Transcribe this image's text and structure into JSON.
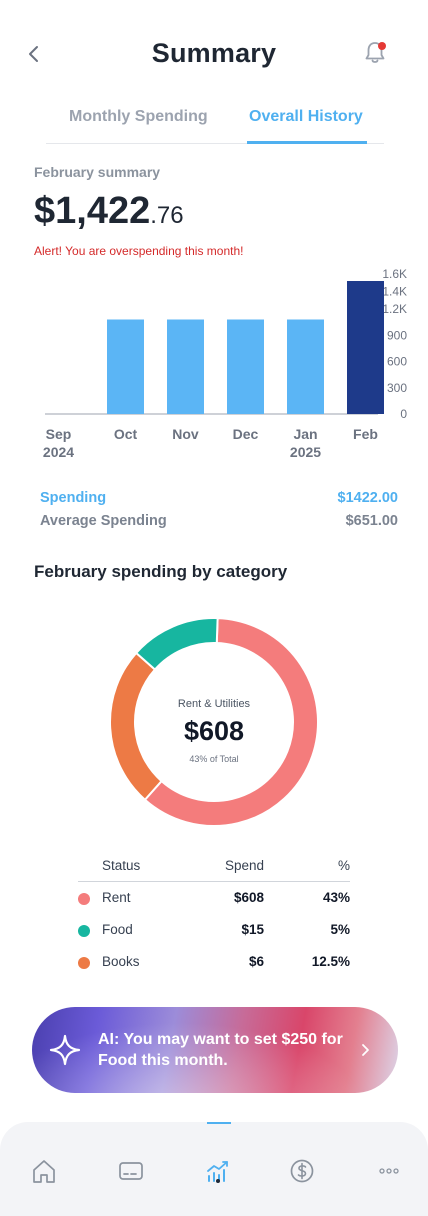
{
  "header": {
    "title": "Summary"
  },
  "tabs": [
    {
      "label": "Monthly Spending",
      "active": false
    },
    {
      "label": "Overall History",
      "active": true
    }
  ],
  "summary": {
    "label": "February summary",
    "amount_main": "$1,422",
    "amount_cents": ".76",
    "alert": "Alert! You are overspending this month!"
  },
  "chart_data": {
    "type": "bar",
    "categories": [
      "Sep 2024",
      "Oct",
      "Nov",
      "Dec",
      "Jan 2025",
      "Feb"
    ],
    "values": [
      0,
      1080,
      1080,
      1080,
      1080,
      1520
    ],
    "highlight_index": 5,
    "y_ticks": [
      "0",
      "300",
      "600",
      "900",
      "1.2K",
      "1.4K",
      "1.6K"
    ],
    "y_tick_values": [
      0,
      300,
      600,
      900,
      1200,
      1400,
      1600
    ],
    "ylim": [
      0,
      1600
    ],
    "colors": {
      "bar": "#5bb5f5",
      "highlight": "#1e3a8a"
    }
  },
  "stats": {
    "spending_label": "Spending",
    "spending_value": "$1422.00",
    "average_label": "Average Spending",
    "average_value": "$651.00"
  },
  "category": {
    "title": "February spending by category",
    "center_label": "Rent & Utilities",
    "center_value": "$608",
    "center_sub": "43% of Total",
    "donut": [
      {
        "name": "Rent",
        "fraction": 0.61,
        "color": "#f47c7c"
      },
      {
        "name": "Books",
        "fraction": 0.25,
        "color": "#ed7a45"
      },
      {
        "name": "Food",
        "fraction": 0.14,
        "color": "#17b6a0"
      }
    ]
  },
  "table": {
    "headers": {
      "status": "Status",
      "spend": "Spend",
      "pct": "%"
    },
    "rows": [
      {
        "name": "Rent",
        "spend": "$608",
        "pct": "43%",
        "color": "#f47c7c"
      },
      {
        "name": "Food",
        "spend": "$15",
        "pct": "5%",
        "color": "#17b6a0"
      },
      {
        "name": "Books",
        "spend": "$6",
        "pct": "12.5%",
        "color": "#ed7a45"
      }
    ]
  },
  "ai_banner": {
    "text": "AI: You may want to set $250 for Food this month."
  },
  "nav": {
    "items": [
      {
        "name": "home-icon"
      },
      {
        "name": "card-icon"
      },
      {
        "name": "chart-icon",
        "active": true
      },
      {
        "name": "dollar-icon"
      },
      {
        "name": "more-icon"
      }
    ]
  },
  "colors": {
    "accent": "#4fb0f0",
    "alert": "#d42a2a",
    "notification_dot": "#e53935"
  }
}
